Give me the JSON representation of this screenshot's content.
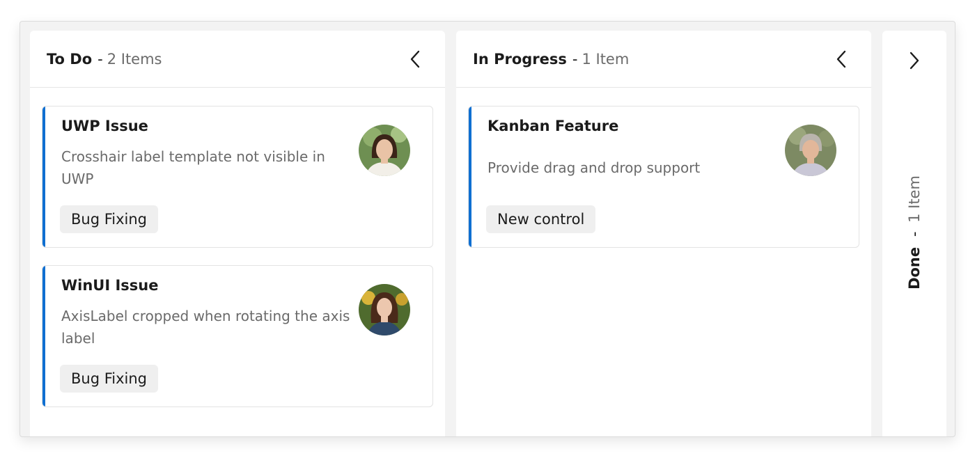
{
  "columns": [
    {
      "title": "To Do",
      "separator": "-",
      "count_label": "2 Items",
      "chevron": "chevron-left-icon",
      "cards": [
        {
          "title": "UWP Issue",
          "description": "Crosshair label template not visible in UWP",
          "tag": "Bug Fixing",
          "avatar": "avatar-woman-dark-hair"
        },
        {
          "title": "WinUI Issue",
          "description": "AxisLabel cropped when rotating the axis label",
          "tag": "Bug Fixing",
          "avatar": "avatar-woman-brown-hair"
        }
      ]
    },
    {
      "title": "In Progress",
      "separator": "-",
      "count_label": "1 Item",
      "chevron": "chevron-left-icon",
      "cards": [
        {
          "title": "Kanban Feature",
          "description": "Provide drag and drop support",
          "tag": "New control",
          "avatar": "avatar-woman-gray-hair"
        }
      ]
    },
    {
      "title": "Done",
      "separator": "-",
      "count_label": "1 Item",
      "chevron": "chevron-right-icon",
      "collapsed": true
    }
  ],
  "colors": {
    "accent": "#0f6fd1",
    "tag_background": "#efefef",
    "board_background": "#f3f3f3"
  }
}
